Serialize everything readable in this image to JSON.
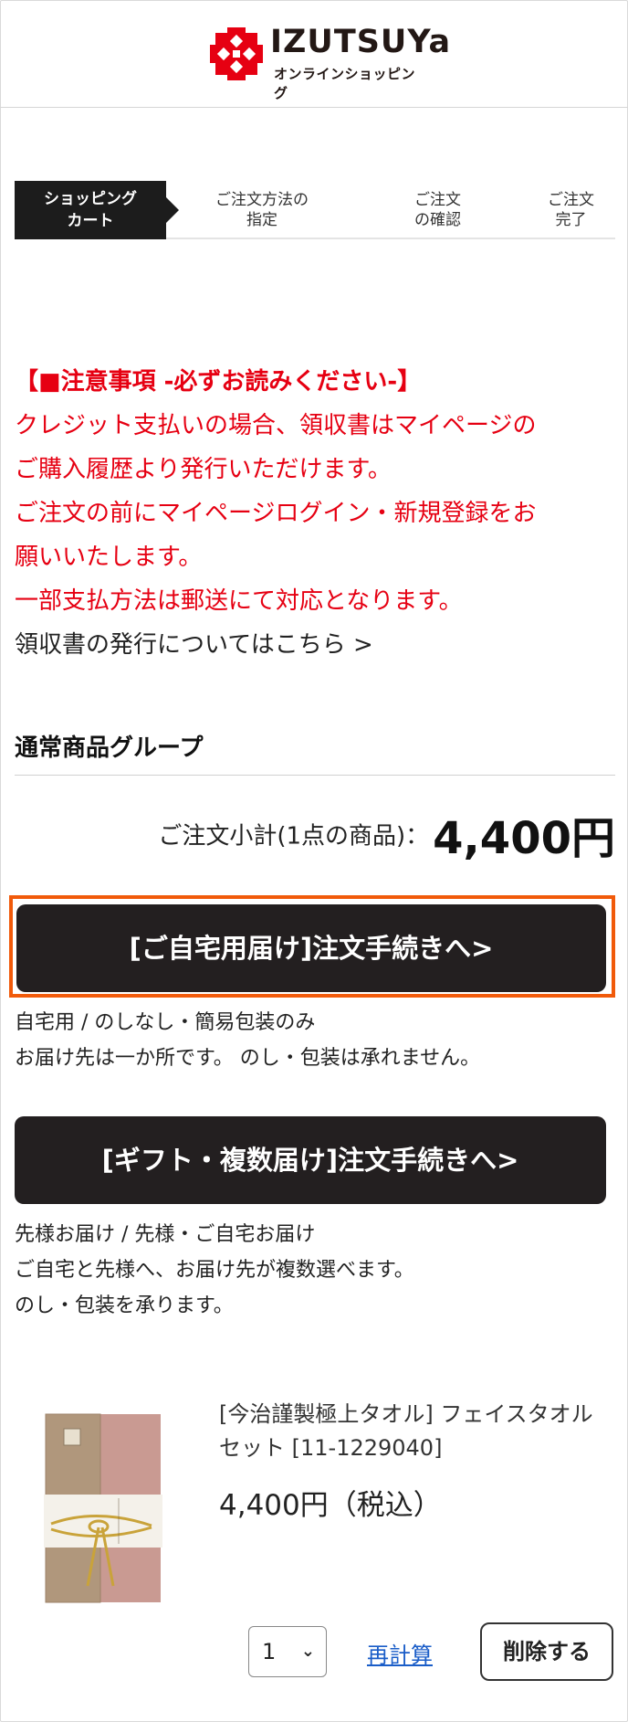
{
  "header": {
    "logo_text": "IZUTSUYa",
    "logo_sub": "オンラインショッピング"
  },
  "steps": [
    {
      "label_1": "ショッピング",
      "label_2": "カート",
      "active": true
    },
    {
      "label_1": "ご注文方法の",
      "label_2": "指定",
      "active": false
    },
    {
      "label_1": "ご注文",
      "label_2": "の確認",
      "active": false
    },
    {
      "label_1": "ご注文",
      "label_2": "完了",
      "active": false
    }
  ],
  "notice": {
    "title": "【■注意事項 -必ずお読みください-】",
    "lines": [
      "クレジット支払いの場合、領収書はマイページの",
      "ご購入履歴より発行いただけます。",
      "ご注文の前にマイページログイン・新規登録をお",
      "願いいたします。",
      "一部支払方法は郵送にて対応となります。"
    ],
    "link": "領収書の発行についてはこちら >"
  },
  "group": {
    "title": "通常商品グループ",
    "subtotal_label": "ご注文小計(1点の商品)：",
    "subtotal_value": "4,400円"
  },
  "checkout_home": {
    "label": "[ご自宅用届け]注文手続きへ>",
    "desc_1": "自宅用 / のしなし・簡易包装のみ",
    "desc_2": "お届け先は一か所です。 のし・包装は承れません。"
  },
  "checkout_gift": {
    "label": "[ギフト・複数届け]注文手続きへ>",
    "desc_1": "先様お届け / 先様・ご自宅お届け",
    "desc_2": "ご自宅と先様へ、お届け先が複数選べます。",
    "desc_3": "のし・包装を承ります。"
  },
  "product": {
    "name": "[今治謹製極上タオル] フェイスタオルセット [11-1229040]",
    "price": "4,400円（税込）",
    "quantity": "1",
    "recalc_label": "再計算",
    "delete_label": "削除する"
  },
  "colors": {
    "notice_red": "#e60012",
    "button_dark": "#231f20",
    "highlight_orange": "#f15a0a",
    "link_blue": "#1a5dc8",
    "logo_red": "#e60012"
  }
}
